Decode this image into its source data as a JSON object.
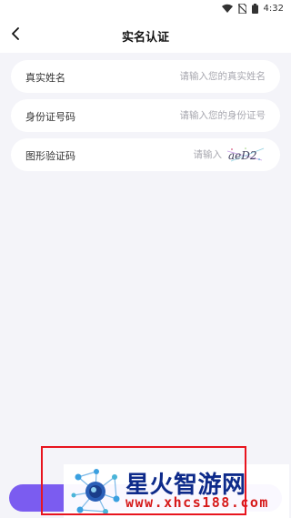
{
  "status_bar": {
    "time": "4:32"
  },
  "header": {
    "title": "实名认证"
  },
  "form": {
    "fields": [
      {
        "label": "真实姓名",
        "placeholder": "请输入您的真实姓名"
      },
      {
        "label": "身份证号码",
        "placeholder": "请输入您的身份证号"
      },
      {
        "label": "图形验证码",
        "placeholder": "请输入"
      }
    ],
    "captcha_text": "aeD2"
  },
  "bottom_button": {
    "label": ""
  },
  "watermark": {
    "name": "星火智游网",
    "url": "www.xhcs188.com"
  },
  "colors": {
    "accent": "#7b5cf0",
    "background": "#f4f4f9",
    "frame": "#e8141e",
    "watermark_blue": "#0d2a8a",
    "watermark_red": "#d61a1a"
  }
}
